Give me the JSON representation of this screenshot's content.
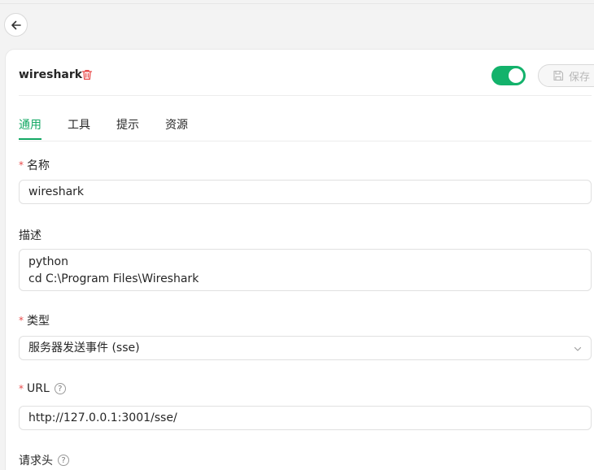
{
  "server": {
    "name": "wireshark",
    "enabled": true,
    "save_label": "保存"
  },
  "tabs": [
    {
      "label": "通用",
      "active": true
    },
    {
      "label": "工具",
      "active": false
    },
    {
      "label": "提示",
      "active": false
    },
    {
      "label": "资源",
      "active": false
    }
  ],
  "form": {
    "required_mark": "*",
    "help_mark": "?",
    "name_label": "名称",
    "name_value": "wireshark",
    "description_label": "描述",
    "description_lines": [
      "python",
      "cd  C:\\Program Files\\Wireshark"
    ],
    "type_label": "类型",
    "type_value": "服务器发送事件 (sse)",
    "url_label": "URL",
    "url_value": "http://127.0.0.1:3001/sse/",
    "headers_label": "请求头"
  },
  "colors": {
    "accent": "#13a864",
    "required": "#e84a4a",
    "toggle_on": "#13b26b"
  },
  "icons": {
    "back": "arrow-left-icon",
    "delete": "trash-icon",
    "save": "save-icon",
    "dropdown": "chevron-down-icon",
    "help": "question-circle-icon"
  }
}
